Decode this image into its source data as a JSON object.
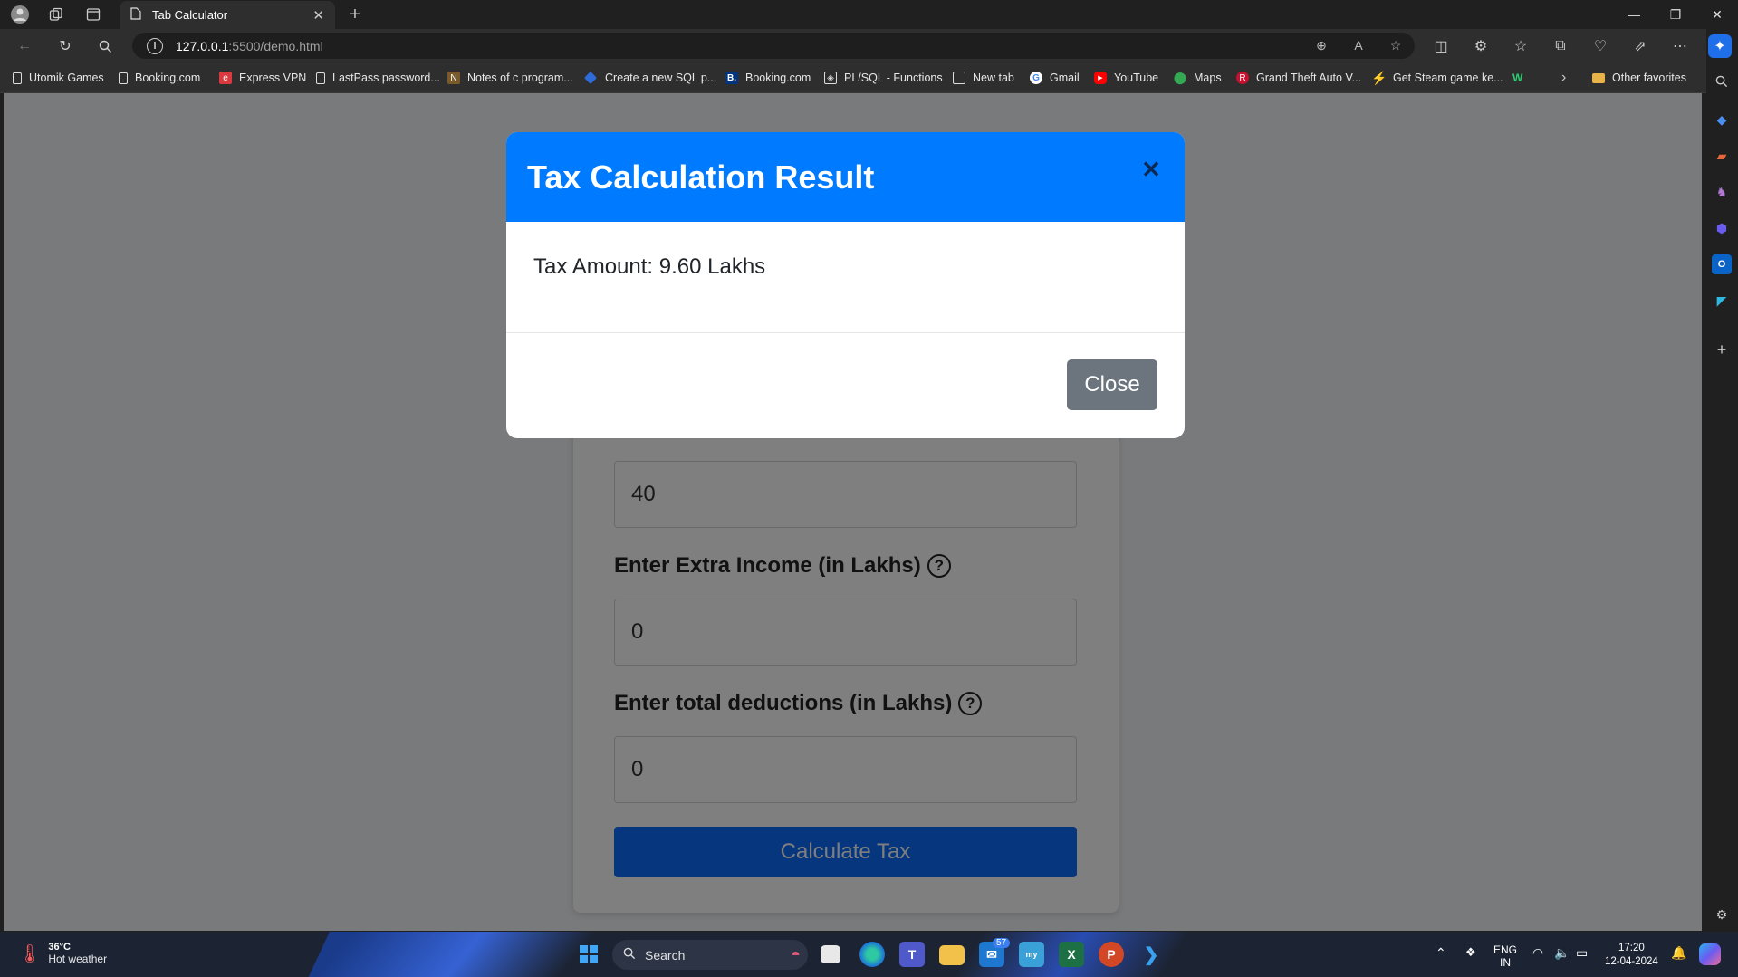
{
  "browser": {
    "tab_title": "Tab Calculator",
    "url_host": "127.0.0.1",
    "url_path": ":5500/demo.html",
    "favorites": [
      {
        "label": "Utomik Games",
        "icon": "page-icon"
      },
      {
        "label": "Booking.com",
        "icon": "page-icon"
      },
      {
        "label": "Express VPN",
        "icon": "expressvpn-icon"
      },
      {
        "label": "LastPass password...",
        "icon": "page-icon"
      },
      {
        "label": "Notes of c program...",
        "icon": "notes-icon"
      },
      {
        "label": "Create a new SQL p...",
        "icon": "diamond-icon"
      },
      {
        "label": "Booking.com",
        "icon": "booking-icon"
      },
      {
        "label": "PL/SQL - Functions",
        "icon": "site-icon"
      },
      {
        "label": "New tab",
        "icon": "newtab-icon"
      },
      {
        "label": "Gmail",
        "icon": "google-icon"
      },
      {
        "label": "YouTube",
        "icon": "youtube-icon"
      },
      {
        "label": "Maps",
        "icon": "maps-icon"
      },
      {
        "label": "Grand Theft Auto V...",
        "icon": "gta-icon"
      },
      {
        "label": "Get Steam game ke...",
        "icon": "bolt-icon"
      }
    ],
    "other_favorites": "Other favorites"
  },
  "form": {
    "income_value": "40",
    "extra_income_label": "Enter Extra Income (in Lakhs)",
    "extra_income_value": "0",
    "deductions_label": "Enter total deductions (in Lakhs)",
    "deductions_value": "0",
    "help_glyph": "?",
    "calculate_label": "Calculate Tax"
  },
  "modal": {
    "title": "Tax Calculation Result",
    "body": "Tax Amount: 9.60 Lakhs",
    "close_label": "Close"
  },
  "taskbar": {
    "weather_temp": "36°C",
    "weather_desc": "Hot weather",
    "search_placeholder": "Search",
    "mail_badge": "57",
    "lang_top": "ENG",
    "lang_bottom": "IN",
    "time": "17:20",
    "date": "12-04-2024"
  },
  "colors": {
    "modal_header": "#007bff",
    "calculate_button": "#0d6efd",
    "close_button": "#6c757d"
  }
}
